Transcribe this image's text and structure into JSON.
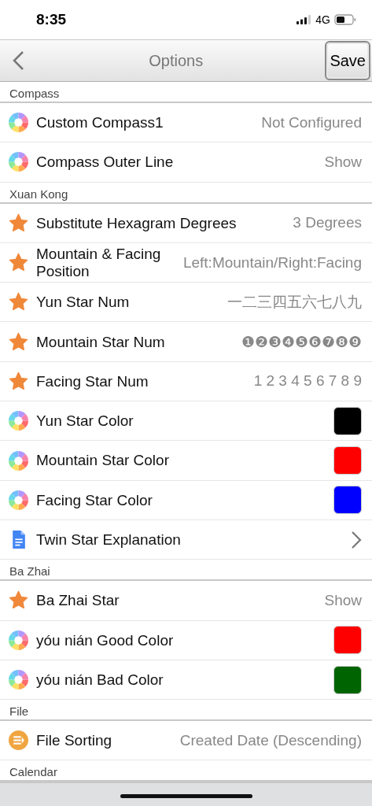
{
  "status_bar": {
    "time": "8:35",
    "network": "4G"
  },
  "nav": {
    "title": "Options",
    "save": "Save"
  },
  "sections": [
    {
      "title": "Compass",
      "rows": [
        {
          "kind": "wheel",
          "label": "Custom Compass1",
          "value": "Not Configured"
        },
        {
          "kind": "wheel",
          "label": "Compass Outer Line",
          "value": "Show"
        }
      ]
    },
    {
      "title": "Xuan Kong",
      "rows": [
        {
          "kind": "star",
          "label": "Substitute Hexagram Degrees",
          "value": "3 Degrees"
        },
        {
          "kind": "star",
          "label": "Mountain & Facing Position",
          "value": "Left:Mountain/Right:Facing"
        },
        {
          "kind": "star",
          "label": "Yun Star Num",
          "value": "一二三四五六七八九"
        },
        {
          "kind": "star",
          "label": "Mountain Star Num",
          "value": "❶❷❸❹❺❻❼❽❾"
        },
        {
          "kind": "star",
          "label": "Facing Star Num",
          "value": "1 2 3 4 5 6 7 8 9"
        },
        {
          "kind": "wheel",
          "label": "Yun Star Color",
          "color": "#000000"
        },
        {
          "kind": "wheel",
          "label": "Mountain Star Color",
          "color": "#ff0000"
        },
        {
          "kind": "wheel",
          "label": "Facing Star Color",
          "color": "#0000ff"
        },
        {
          "kind": "doc",
          "label": "Twin Star Explanation"
        }
      ]
    },
    {
      "title": "Ba Zhai",
      "rows": [
        {
          "kind": "star",
          "label": "Ba Zhai Star",
          "value": "Show"
        },
        {
          "kind": "wheel",
          "label": "yóu nián Good Color",
          "color": "#ff0000"
        },
        {
          "kind": "wheel",
          "label": "yóu nián Bad Color",
          "color": "#006400"
        }
      ]
    },
    {
      "title": "File",
      "rows": [
        {
          "kind": "sort",
          "label": "File Sorting",
          "value": "Created Date (Descending)"
        }
      ]
    },
    {
      "title": "Calendar"
    }
  ]
}
